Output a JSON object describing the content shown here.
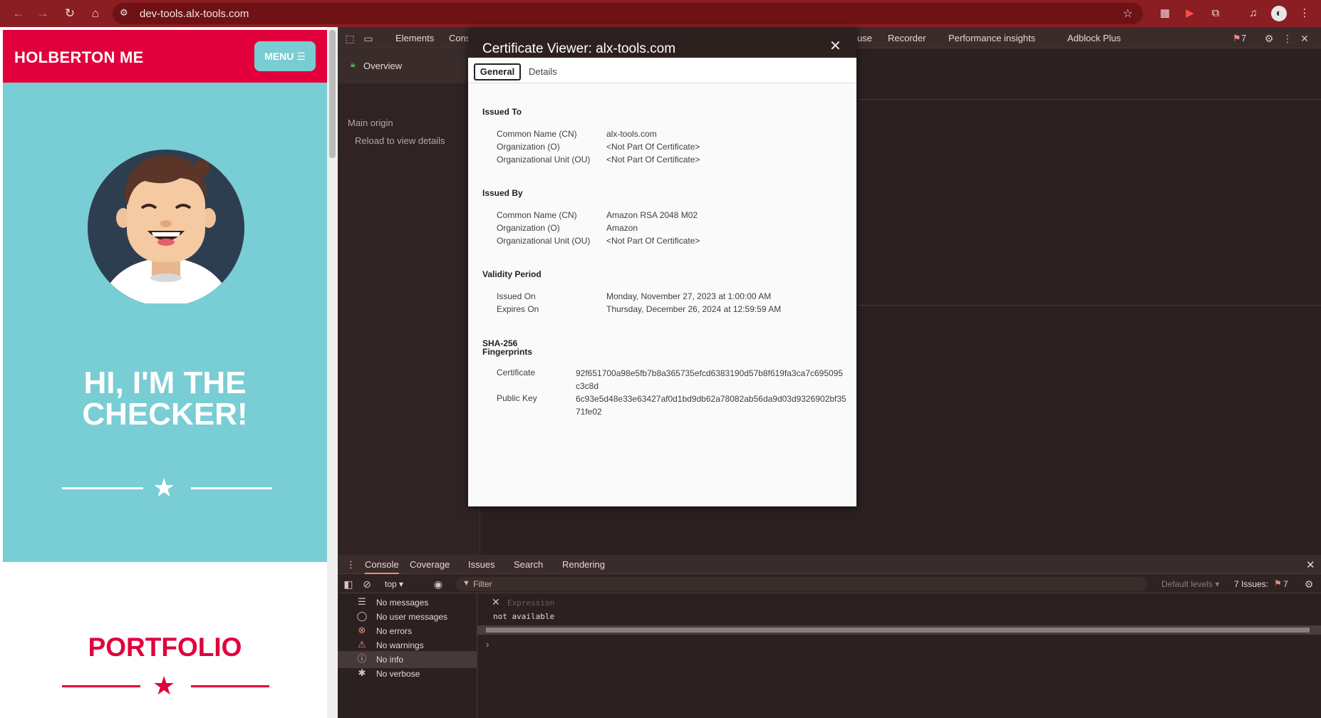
{
  "browser": {
    "url": "dev-tools.alx-tools.com"
  },
  "site": {
    "brand": "HOLBERTON ME",
    "menu_label": "MENU ☰",
    "hero_title_line1": "HI, I'M THE",
    "hero_title_line2": "CHECKER!",
    "portfolio_title": "PORTFOLIO",
    "colors": {
      "brand": "#e1003c",
      "hero": "#79cdd4"
    }
  },
  "devtools": {
    "tabs": [
      "Elements",
      "Cons",
      "use",
      "Recorder",
      "Performance insights",
      "Adblock Plus"
    ],
    "issues_badge": "7",
    "security": {
      "overview": "Overview",
      "main_origin": "Main origin",
      "reload_hint": "Reload to view details"
    },
    "drawer": {
      "tabs": [
        "Console",
        "Coverage",
        "Issues",
        "Search",
        "Rendering"
      ],
      "context": "top",
      "filter_placeholder": "Filter",
      "levels": "Default levels",
      "issues_label": "7 Issues:",
      "issues_count": "7",
      "messages": [
        {
          "icon": "list-icon",
          "label": "No messages"
        },
        {
          "icon": "user-icon",
          "label": "No user messages"
        },
        {
          "icon": "error-icon",
          "label": "No errors"
        },
        {
          "icon": "warning-icon",
          "label": "No warnings"
        },
        {
          "icon": "info-icon",
          "label": "No info"
        },
        {
          "icon": "bug-icon",
          "label": "No verbose"
        }
      ],
      "expression_placeholder": "Expression",
      "expression_result": "not available"
    }
  },
  "certificate": {
    "title": "Certificate Viewer: alx-tools.com",
    "tabs": {
      "general": "General",
      "details": "Details"
    },
    "issued_to": {
      "heading": "Issued To",
      "rows": [
        {
          "label": "Common Name (CN)",
          "value": "alx-tools.com"
        },
        {
          "label": "Organization (O)",
          "value": "<Not Part Of Certificate>"
        },
        {
          "label": "Organizational Unit (OU)",
          "value": "<Not Part Of Certificate>"
        }
      ]
    },
    "issued_by": {
      "heading": "Issued By",
      "rows": [
        {
          "label": "Common Name (CN)",
          "value": "Amazon RSA 2048 M02"
        },
        {
          "label": "Organization (O)",
          "value": "Amazon"
        },
        {
          "label": "Organizational Unit (OU)",
          "value": "<Not Part Of Certificate>"
        }
      ]
    },
    "validity": {
      "heading": "Validity Period",
      "rows": [
        {
          "label": "Issued On",
          "value": "Monday, November 27, 2023 at 1:00:00 AM"
        },
        {
          "label": "Expires On",
          "value": "Thursday, December 26, 2024 at 12:59:59 AM"
        }
      ]
    },
    "fingerprints": {
      "heading_line1": "SHA-256",
      "heading_line2": "Fingerprints",
      "certificate_label": "Certificate",
      "certificate_value": "92f651700a98e5fb7b8a365735efcd6383190d57b8f619fa3ca7c695095c3c8d",
      "public_key_label": "Public Key",
      "public_key_value": "6c93e5d48e33e63427af0d1bd9db62a78082ab56da9d03d9326902bf3571fe02"
    }
  }
}
